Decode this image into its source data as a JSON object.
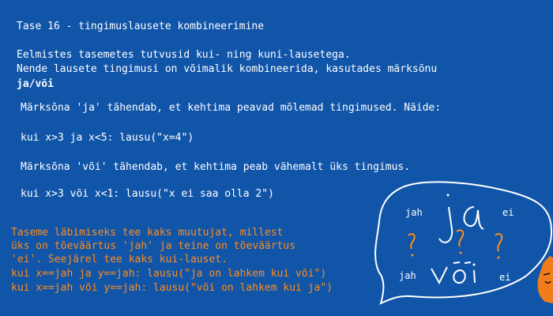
{
  "level": {
    "title": "Tase 16 - tingimuslausete kombineerimine",
    "intro_1": "Eelmistes tasemetes tutvusid kui- ning kuni-lausetega.",
    "intro_2": "Nende lausete tingimusi on võimalik kombineerida, kasutades märksõnu",
    "keywords": "ja/või",
    "ja_explanation": "Märksõna 'ja' tähendab, et kehtima peavad mõlemad tingimused. Näide:",
    "ja_example": "kui x>3 ja x<5: lausu(\"x=4\")",
    "voi_explanation": "Märksõna 'või' tähendab, et kehtima peab vähemalt üks tingimus.",
    "voi_example": "kui x>3 või x<1: lausu(\"x ei saa olla 2\")"
  },
  "task": {
    "line_1": "Taseme läbimiseks tee kaks muutujat, millest",
    "line_2": "üks on tõeväärtus 'jah' ja teine on tõeväärtus",
    "line_3": "'ei'. Seejärel tee kaks kui-lauset.",
    "line_4": "kui x==jah ja y==jah: lausu(\"ja on lahkem kui või\")",
    "line_5": "kui x==jah või y==jah: lausu(\"või on lahkem kui ja\")"
  },
  "drawing": {
    "top_left": "jah",
    "top_right": "ei",
    "bottom_left": "jah",
    "bottom_right": "ei"
  },
  "colors": {
    "background": "#1155a9",
    "text": "#ffffff",
    "task_text": "#ff8c1a",
    "character": "#f07c1c"
  }
}
